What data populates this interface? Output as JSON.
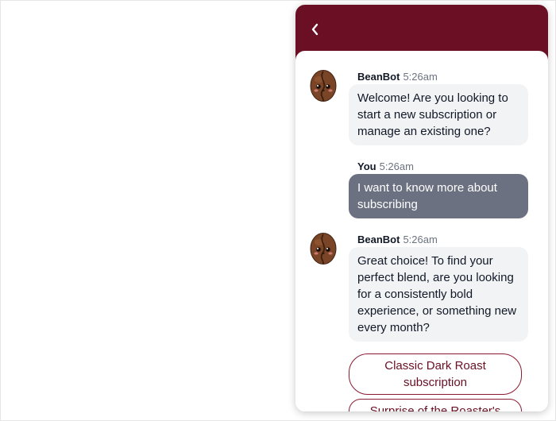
{
  "colors": {
    "header": "#6a0f24",
    "bot_bubble": "#f2f3f5",
    "user_bubble": "#6b7180",
    "option_text": "#6a0f24",
    "option_border": "#8b1a33"
  },
  "header": {
    "back_icon": "chevron-left-icon"
  },
  "messages": [
    {
      "sender": "BeanBot",
      "time": "5:26am",
      "avatar": "coffee-bean-icon",
      "text": "Welcome! Are you looking to start a new subscription or manage an existing one?"
    },
    {
      "sender": "You",
      "time": "5:26am",
      "text": "I want to know more about subscribing"
    },
    {
      "sender": "BeanBot",
      "time": "5:26am",
      "avatar": "coffee-bean-icon",
      "text": "Great choice! To find your perfect blend, are you looking for a consistently bold experience, or something new every month?"
    }
  ],
  "options": [
    {
      "label": "Classic Dark Roast subscription"
    },
    {
      "label": "Surprise of the Roaster's"
    }
  ]
}
